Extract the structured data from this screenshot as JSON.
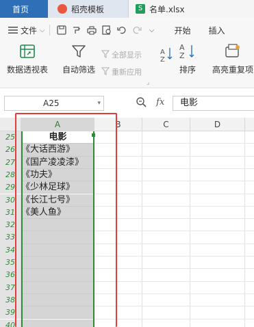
{
  "tabs": [
    {
      "label": "首页"
    },
    {
      "label": "稻壳模板"
    },
    {
      "label": "名单.xlsx",
      "icon_text": "S"
    }
  ],
  "menubar": {
    "file_label": "文件",
    "start_label": "开始",
    "insert_label": "插入"
  },
  "ribbon": {
    "pivot_label": "数据透视表",
    "autofilter_label": "自动筛选",
    "show_all_label": "全部显示",
    "reapply_label": "重新应用",
    "sort_label": "排序",
    "highlight_dup_label": "高亮重复项"
  },
  "formula_bar": {
    "cell_ref": "A25",
    "fx_label": "fx",
    "content": "电影"
  },
  "columns": [
    "A",
    "B",
    "C",
    "D"
  ],
  "rows": [
    {
      "num": "25",
      "a": "电影"
    },
    {
      "num": "26",
      "a": "《大话西游》"
    },
    {
      "num": "27",
      "a": "《国产凌凌漆》"
    },
    {
      "num": "28",
      "a": "《功夫》"
    },
    {
      "num": "29",
      "a": "《少林足球》"
    },
    {
      "num": "30",
      "a": "《长江七号》"
    },
    {
      "num": "31",
      "a": "《美人鱼》"
    },
    {
      "num": "32",
      "a": ""
    },
    {
      "num": "33",
      "a": ""
    },
    {
      "num": "34",
      "a": ""
    },
    {
      "num": "35",
      "a": ""
    },
    {
      "num": "36",
      "a": ""
    },
    {
      "num": "37",
      "a": ""
    },
    {
      "num": "38",
      "a": ""
    },
    {
      "num": "39",
      "a": ""
    },
    {
      "num": "40",
      "a": ""
    }
  ],
  "colors": {
    "tab_blue": "#2f6fb7",
    "selection_green": "#2e8b3a",
    "annotation_red": "#e23b3b"
  }
}
